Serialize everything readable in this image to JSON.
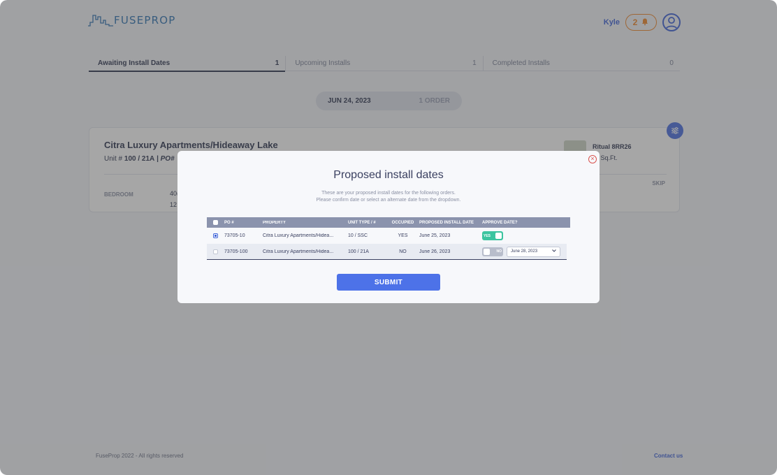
{
  "header": {
    "brand": "FUSEPROP",
    "user_name": "Kyle",
    "notification_count": "2"
  },
  "tabs": [
    {
      "label": "Awaiting Install Dates",
      "count": "1"
    },
    {
      "label": "Upcoming Installs",
      "count": "1"
    },
    {
      "label": "Completed Installs",
      "count": "0"
    }
  ],
  "date_group": {
    "date": "JUN 24, 2023",
    "count": "1 ORDER"
  },
  "order_card": {
    "title": "Citra Luxury Apartments/Hideaway Lake",
    "unit_label": "Unit # ",
    "unit_value": "100 / 21A",
    "po_label": " | PO#",
    "room": "BEDROOM",
    "room_value_1": "40(",
    "room_value_2": "12",
    "carpet_name": "Ritual 8RR26",
    "carpet_amount": "0 Sq.Ft.",
    "skip": "SKIP"
  },
  "modal": {
    "title": "Proposed install dates",
    "desc_line1": "These are your proposed install dates for the following orders.",
    "desc_line2": "Please confirm date or select an alternate date from the dropdown.",
    "columns": {
      "po": "PO #",
      "property": "PROPERTY",
      "unit": "UNIT TYPE / #",
      "occupied": "OCCUPIED",
      "date": "PROPOSED INSTALL DATE",
      "approve": "APPROVE DATE?"
    },
    "rows": [
      {
        "po": "73705-10",
        "property": "Citra Luxury Apartments/Hidea...",
        "unit": "10 / SSC",
        "occupied": "YES",
        "date": "June 25, 2023",
        "approve": "YES"
      },
      {
        "po": "73705-100",
        "property": "Citra Luxury Apartments/Hidea...",
        "unit": "100 / 21A",
        "occupied": "NO",
        "date": "June 26, 2023",
        "approve": "NO",
        "alt_date": "June 28, 2023"
      }
    ],
    "submit": "SUBMIT"
  },
  "footer": {
    "copyright": "FuseProp 2022 - All rights reserved",
    "contact": "Contact us"
  },
  "colors": {
    "brand_blue": "#3f63d8",
    "accent_orange": "#f0862a",
    "toggle_yes": "#3cc4a0",
    "submit": "#4d72e8"
  }
}
